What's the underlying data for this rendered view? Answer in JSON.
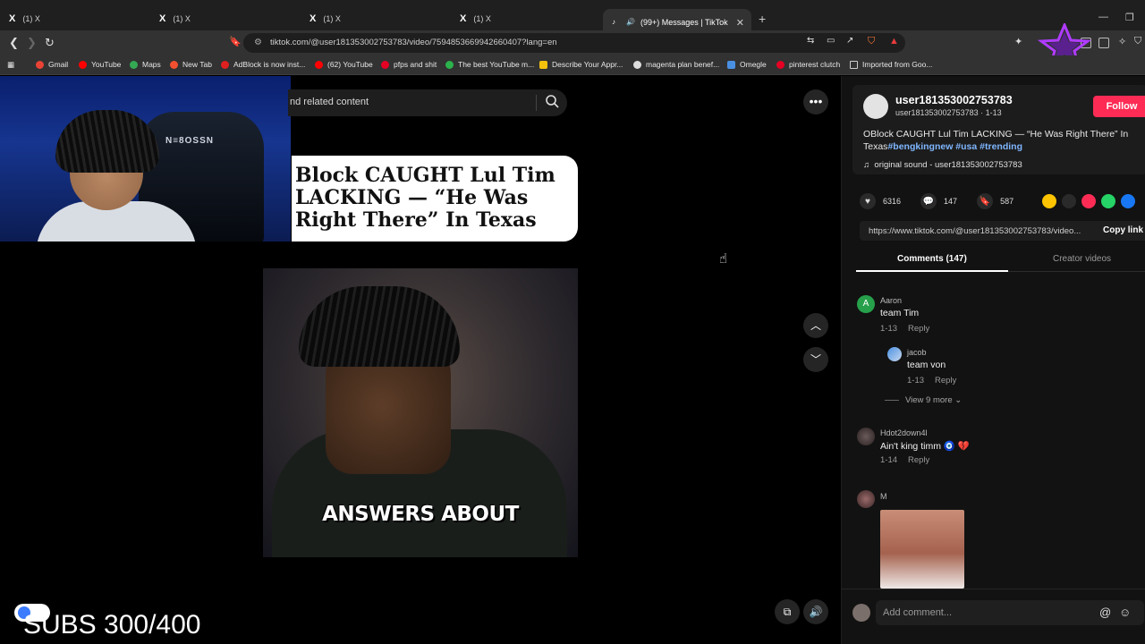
{
  "tabs": [
    {
      "label": "(1) X"
    },
    {
      "label": "(1) X"
    },
    {
      "label": "(1) X"
    },
    {
      "label": "(1) X"
    },
    {
      "label": "(99+) Messages | TikTok"
    }
  ],
  "address_bar": {
    "url": "tiktok.com/@user181353002753783/video/7594853669942660407?lang=en"
  },
  "bookmarks": [
    {
      "label": "Gmail"
    },
    {
      "label": "YouTube"
    },
    {
      "label": "Maps"
    },
    {
      "label": "New Tab"
    },
    {
      "label": "AdBlock is now inst..."
    },
    {
      "label": "(62) YouTube"
    },
    {
      "label": "pfps and shit"
    },
    {
      "label": "The best YouTube m..."
    },
    {
      "label": "Describe Your Appr..."
    },
    {
      "label": "magenta plan benef..."
    },
    {
      "label": "Omegle"
    },
    {
      "label": "pinterest clutch"
    },
    {
      "label": "Imported from Goo..."
    }
  ],
  "webcam": {
    "chair_label": "N≡8OSSN"
  },
  "search": {
    "placeholder": "nd related content"
  },
  "video": {
    "headline": "Block CAUGHT Lul Tim LACKING — “He Was Right There” In Texas",
    "caption": "ANSWERS ABOUT"
  },
  "overlay": {
    "subs": "SUBS 300/400"
  },
  "panel": {
    "username": "user181353002753783",
    "sub": "user181353002753783 · 1-13",
    "follow": "Follow",
    "description": "OBlock CAUGHT Lul Tim LACKING — “He Was Right There” In Texas",
    "hashtags": [
      "#bengkingnew",
      "#usa",
      "#trending"
    ],
    "sound": "original sound - user181353002753783",
    "likes": "6316",
    "comments_count": "147",
    "saves": "587",
    "link": "https://www.tiktok.com/@user181353002753783/video...",
    "copy_link": "Copy link",
    "tab_comments": "Comments (147)",
    "tab_creator": "Creator videos",
    "add_comment": "Add comment..."
  },
  "comments": [
    {
      "name": "Aaron",
      "avatar_letter": "A",
      "text": "team Tim",
      "date": "1-13",
      "reply": "Reply"
    },
    {
      "name": "jacob",
      "text": "team von",
      "date": "1-13",
      "reply": "Reply"
    },
    {
      "name": "Hdot2down4l",
      "text": "Ain't king timm 🧿 💔",
      "date": "1-14",
      "reply": "Reply"
    },
    {
      "name": "M"
    }
  ],
  "view_more": "View 9 more",
  "colors": {
    "accent": "#fe2c55",
    "hashtag": "#7fb6ff",
    "panel_bg": "#121212"
  }
}
